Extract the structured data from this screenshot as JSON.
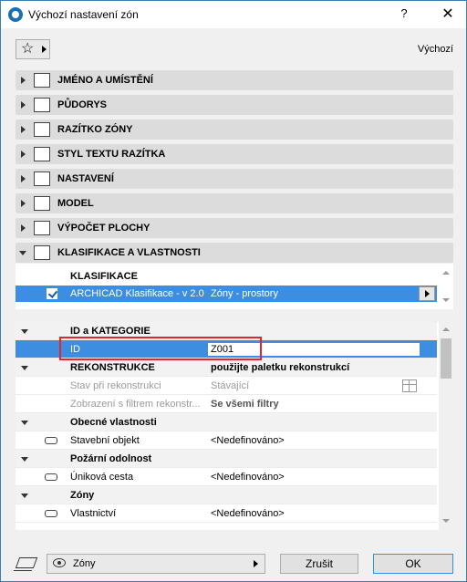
{
  "window": {
    "title": "Výchozí nastavení zón",
    "help_label": "?",
    "close_label": "✕"
  },
  "toolbar": {
    "favorites_icon": "star-icon",
    "default_label": "Výchozí"
  },
  "panels": [
    {
      "label": "JMÉNO A UMÍSTĚNÍ",
      "icon": "name-location-icon"
    },
    {
      "label": "PŮDORYS",
      "icon": "floorplan-icon"
    },
    {
      "label": "RAZÍTKO ZÓNY",
      "icon": "zone-stamp-icon"
    },
    {
      "label": "STYL TEXTU RAZÍTKA",
      "icon": "text-style-icon"
    },
    {
      "label": "NASTAVENÍ",
      "icon": "settings-icon"
    },
    {
      "label": "MODEL",
      "icon": "model-icon"
    },
    {
      "label": "VÝPOČET PLOCHY",
      "icon": "area-calc-icon"
    },
    {
      "label": "KLASIFIKACE A VLASTNOSTI",
      "icon": "classification-icon"
    }
  ],
  "classification": {
    "header": "KLASIFIKACE",
    "row": {
      "system": "ARCHICAD Klasifikace - v 2.0",
      "value": "Zóny - prostory",
      "checked": true
    }
  },
  "properties": {
    "id_group": "ID a KATEGORIE",
    "id_label": "ID",
    "id_value": "Z001",
    "renovation_group": "REKONSTRUKCE",
    "renovation_hint": "použijte paletku rekonstrukcí",
    "renovation_status_label": "Stav při rekonstrukci",
    "renovation_status_value": "Stávající",
    "renovation_filter_label": "Zobrazení s filtrem rekonstr...",
    "renovation_filter_value": "Se všemi filtry",
    "general_group": "Obecné vlastnosti",
    "building_object_label": "Stavební objekt",
    "building_object_value": "<Nedefinováno>",
    "fire_group": "Požární odolnost",
    "escape_route_label": "Úniková cesta",
    "escape_route_value": "<Nedefinováno>",
    "zones_group": "Zóny",
    "ownership_label": "Vlastnictví",
    "ownership_value": "<Nedefinováno>"
  },
  "footer": {
    "layer_value": "Zóny",
    "cancel_label": "Zrušit",
    "ok_label": "OK"
  }
}
